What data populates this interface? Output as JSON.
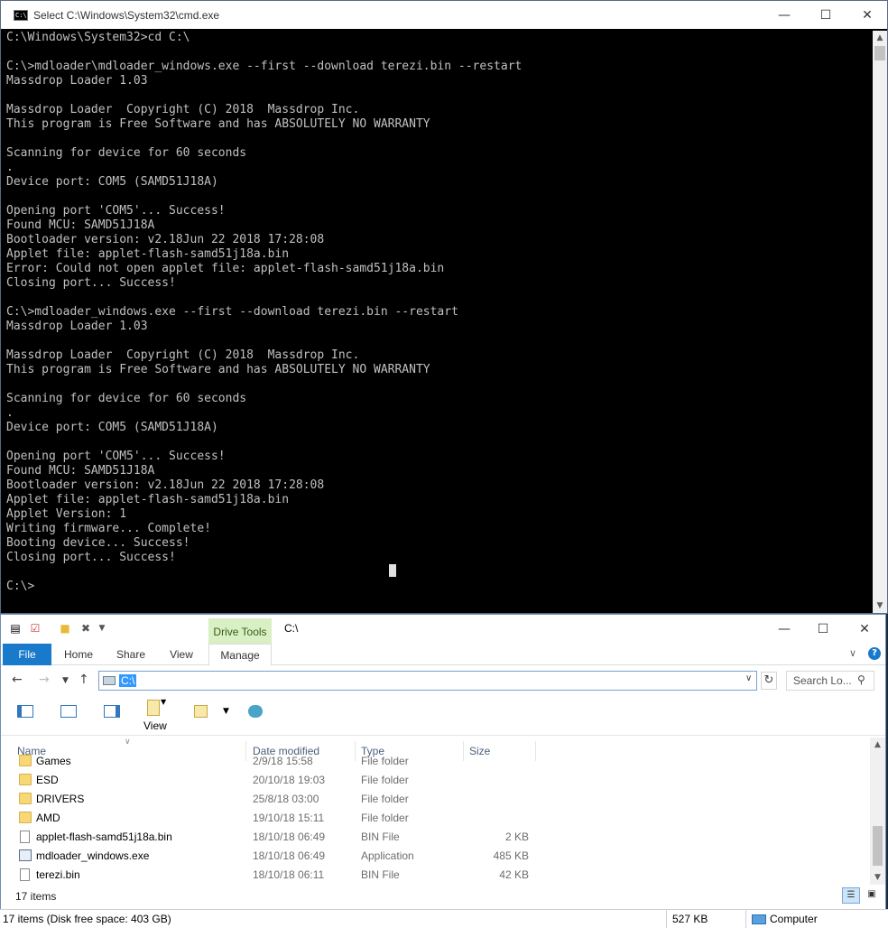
{
  "cmd": {
    "title": "Select C:\\Windows\\System32\\cmd.exe",
    "icon_label": "C:\\",
    "lines": [
      "C:\\Windows\\System32>cd C:\\",
      "",
      "C:\\>mdloader\\mdloader_windows.exe --first --download terezi.bin --restart",
      "Massdrop Loader 1.03",
      "",
      "Massdrop Loader  Copyright (C) 2018  Massdrop Inc.",
      "This program is Free Software and has ABSOLUTELY NO WARRANTY",
      "",
      "Scanning for device for 60 seconds",
      ".",
      "Device port: COM5 (SAMD51J18A)",
      "",
      "Opening port 'COM5'... Success!",
      "Found MCU: SAMD51J18A",
      "Bootloader version: v2.18Jun 22 2018 17:28:08",
      "Applet file: applet-flash-samd51j18a.bin",
      "Error: Could not open applet file: applet-flash-samd51j18a.bin",
      "Closing port... Success!",
      "",
      "C:\\>mdloader_windows.exe --first --download terezi.bin --restart",
      "Massdrop Loader 1.03",
      "",
      "Massdrop Loader  Copyright (C) 2018  Massdrop Inc.",
      "This program is Free Software and has ABSOLUTELY NO WARRANTY",
      "",
      "Scanning for device for 60 seconds",
      ".",
      "Device port: COM5 (SAMD51J18A)",
      "",
      "Opening port 'COM5'... Success!",
      "Found MCU: SAMD51J18A",
      "Bootloader version: v2.18Jun 22 2018 17:28:08",
      "Applet file: applet-flash-samd51j18a.bin",
      "Applet Version: 1",
      "Writing firmware... Complete!",
      "Booting device... Success!",
      "Closing port... Success!",
      "",
      "C:\\>"
    ]
  },
  "explorer": {
    "context_tab": "Drive Tools",
    "title": "C:\\",
    "tabs": {
      "file": "File",
      "home": "Home",
      "share": "Share",
      "view": "View",
      "manage": "Manage"
    },
    "address": "C:\\",
    "search_placeholder": "Search Lo...",
    "view_label": "View",
    "columns": {
      "name": "Name",
      "date": "Date modified",
      "type": "Type",
      "size": "Size"
    },
    "files": [
      {
        "name": "Games",
        "date": "2/9/18 15:58",
        "type": "File folder",
        "size": "",
        "icon": "folder"
      },
      {
        "name": "ESD",
        "date": "20/10/18 19:03",
        "type": "File folder",
        "size": "",
        "icon": "folder"
      },
      {
        "name": "DRIVERS",
        "date": "25/8/18 03:00",
        "type": "File folder",
        "size": "",
        "icon": "folder"
      },
      {
        "name": "AMD",
        "date": "19/10/18 15:11",
        "type": "File folder",
        "size": "",
        "icon": "folder"
      },
      {
        "name": "applet-flash-samd51j18a.bin",
        "date": "18/10/18 06:49",
        "type": "BIN File",
        "size": "2 KB",
        "icon": "document"
      },
      {
        "name": "mdloader_windows.exe",
        "date": "18/10/18 06:49",
        "type": "Application",
        "size": "485 KB",
        "icon": "application"
      },
      {
        "name": "terezi.bin",
        "date": "18/10/18 06:11",
        "type": "BIN File",
        "size": "42 KB",
        "icon": "document"
      }
    ],
    "item_count": "17 items"
  },
  "statusbar": {
    "left": "17 items (Disk free space: 403 GB)",
    "size": "527 KB",
    "location": "Computer"
  }
}
